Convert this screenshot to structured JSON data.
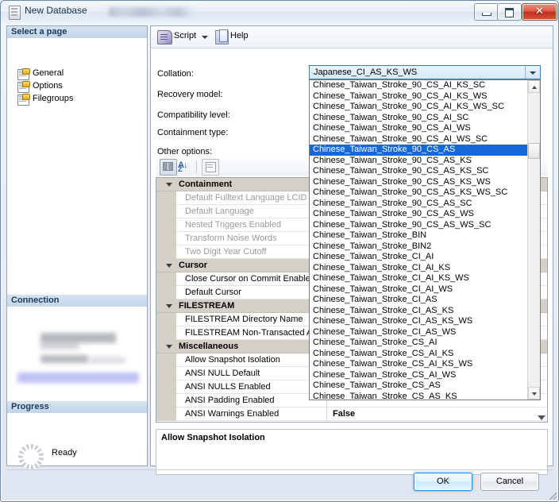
{
  "window": {
    "title": "New Database",
    "icon": "database-page-icon",
    "minimize_label": "Minimize",
    "maximize_label": "Maximize",
    "close_label": "Close"
  },
  "left_pane": {
    "select_page_header": "Select a page",
    "pages": [
      {
        "label": "General",
        "icon": "page-icon"
      },
      {
        "label": "Options",
        "icon": "page-icon"
      },
      {
        "label": "Filegroups",
        "icon": "page-icon"
      }
    ],
    "connection_header": "Connection",
    "progress_header": "Progress",
    "progress_status": "Ready"
  },
  "toolbar": {
    "script_label": "Script",
    "script_icon": "script-icon",
    "script_caret_icon": "chevron-down-icon",
    "help_label": "Help",
    "help_icon": "help-icon"
  },
  "form": {
    "collation_label": "Collation:",
    "recovery_model_label": "Recovery model:",
    "compatibility_level_label": "Compatibility level:",
    "containment_type_label": "Containment type:",
    "other_options_label": "Other options:"
  },
  "collation_combo": {
    "value": "Japanese_CI_AS_KS_WS",
    "arrow_icon": "chevron-down-icon",
    "expanded": true,
    "selected_option": "Chinese_Taiwan_Stroke_90_CS_AS",
    "options": [
      "Chinese_Taiwan_Stroke_90_CS_AI_KS_SC",
      "Chinese_Taiwan_Stroke_90_CS_AI_KS_WS",
      "Chinese_Taiwan_Stroke_90_CS_AI_KS_WS_SC",
      "Chinese_Taiwan_Stroke_90_CS_AI_SC",
      "Chinese_Taiwan_Stroke_90_CS_AI_WS",
      "Chinese_Taiwan_Stroke_90_CS_AI_WS_SC",
      "Chinese_Taiwan_Stroke_90_CS_AS",
      "Chinese_Taiwan_Stroke_90_CS_AS_KS",
      "Chinese_Taiwan_Stroke_90_CS_AS_KS_SC",
      "Chinese_Taiwan_Stroke_90_CS_AS_KS_WS",
      "Chinese_Taiwan_Stroke_90_CS_AS_KS_WS_SC",
      "Chinese_Taiwan_Stroke_90_CS_AS_SC",
      "Chinese_Taiwan_Stroke_90_CS_AS_WS",
      "Chinese_Taiwan_Stroke_90_CS_AS_WS_SC",
      "Chinese_Taiwan_Stroke_BIN",
      "Chinese_Taiwan_Stroke_BIN2",
      "Chinese_Taiwan_Stroke_CI_AI",
      "Chinese_Taiwan_Stroke_CI_AI_KS",
      "Chinese_Taiwan_Stroke_CI_AI_KS_WS",
      "Chinese_Taiwan_Stroke_CI_AI_WS",
      "Chinese_Taiwan_Stroke_CI_AS",
      "Chinese_Taiwan_Stroke_CI_AS_KS",
      "Chinese_Taiwan_Stroke_CI_AS_KS_WS",
      "Chinese_Taiwan_Stroke_CI_AS_WS",
      "Chinese_Taiwan_Stroke_CS_AI",
      "Chinese_Taiwan_Stroke_CS_AI_KS",
      "Chinese_Taiwan_Stroke_CS_AI_KS_WS",
      "Chinese_Taiwan_Stroke_CS_AI_WS",
      "Chinese_Taiwan_Stroke_CS_AS",
      "Chinese_Taiwan_Stroke_CS_AS_KS"
    ],
    "scroll_up_icon": "scroll-up-arrow-icon",
    "scroll_down_icon": "scroll-down-arrow-icon"
  },
  "property_grid": {
    "buttons": [
      {
        "name": "categorized",
        "icon": "categorized-view-icon"
      },
      {
        "name": "alphabetical",
        "icon": "alphabetical-sort-icon"
      },
      {
        "name": "property-pages",
        "icon": "property-pages-icon"
      }
    ],
    "rows": [
      {
        "type": "category",
        "name": "Containment"
      },
      {
        "type": "property",
        "name": "Default Fulltext Language LCID",
        "value": "",
        "disabled": true
      },
      {
        "type": "property",
        "name": "Default Language",
        "value": "",
        "disabled": true
      },
      {
        "type": "property",
        "name": "Nested Triggers Enabled",
        "value": "",
        "disabled": true
      },
      {
        "type": "property",
        "name": "Transform Noise Words",
        "value": "",
        "disabled": true
      },
      {
        "type": "property",
        "name": "Two Digit Year Cutoff",
        "value": "",
        "disabled": true
      },
      {
        "type": "category",
        "name": "Cursor"
      },
      {
        "type": "property",
        "name": "Close Cursor on Commit Enabled",
        "value": "",
        "disabled": false
      },
      {
        "type": "property",
        "name": "Default Cursor",
        "value": "",
        "disabled": false
      },
      {
        "type": "category",
        "name": "FILESTREAM"
      },
      {
        "type": "property",
        "name": "FILESTREAM Directory Name",
        "value": "",
        "disabled": false
      },
      {
        "type": "property",
        "name": "FILESTREAM Non-Transacted Acc",
        "value": "",
        "disabled": false
      },
      {
        "type": "category",
        "name": "Miscellaneous"
      },
      {
        "type": "property",
        "name": "Allow Snapshot Isolation",
        "value": "",
        "disabled": false
      },
      {
        "type": "property",
        "name": "ANSI NULL Default",
        "value": "",
        "disabled": false
      },
      {
        "type": "property",
        "name": "ANSI NULLS Enabled",
        "value": "",
        "disabled": false
      },
      {
        "type": "property",
        "name": "ANSI Padding Enabled",
        "value": "",
        "disabled": false
      },
      {
        "type": "property",
        "name": "ANSI Warnings Enabled",
        "value": "False",
        "disabled": false
      }
    ],
    "scroll_down_icon": "scroll-down-arrow-icon"
  },
  "description": {
    "title": "Allow Snapshot Isolation",
    "body": ""
  },
  "footer": {
    "ok_label": "OK",
    "cancel_label": "Cancel"
  },
  "colors": {
    "selection_blue": "#1569d6",
    "category_gray": "#d4d0c8",
    "combo_border": "#3c7fb1",
    "ok_accent": "#2c8dd9"
  }
}
